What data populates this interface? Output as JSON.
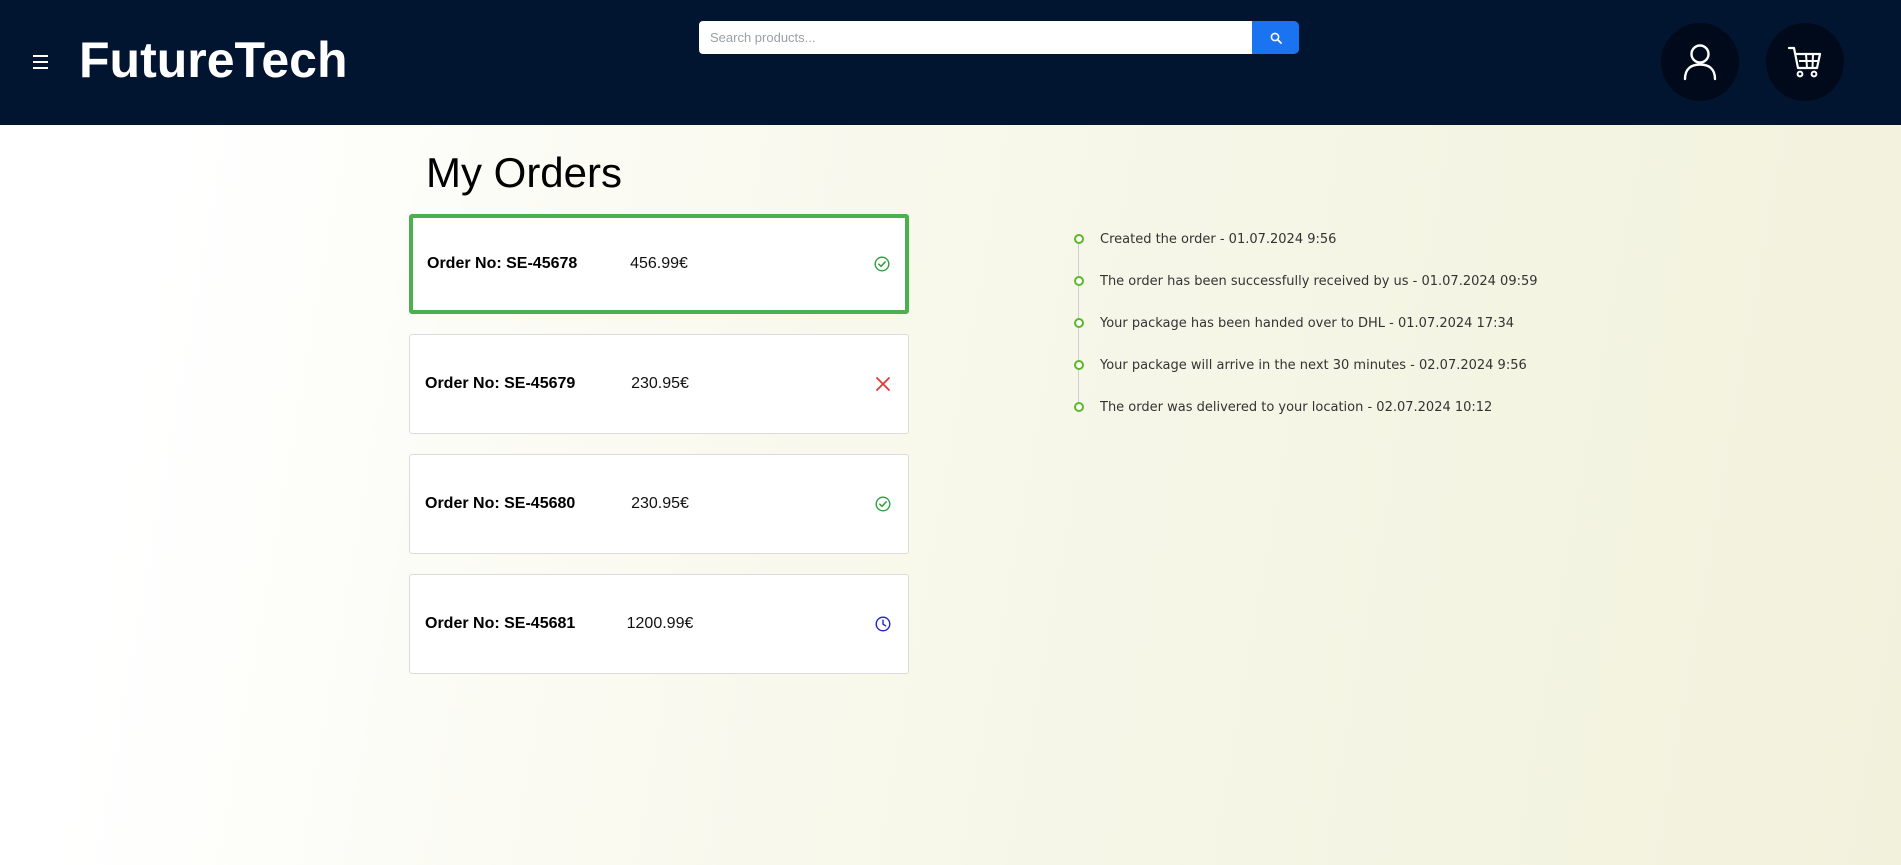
{
  "header": {
    "brand": "FutureTech",
    "search_placeholder": "Search products...",
    "icons": {
      "menu": "hamburger-icon",
      "search": "search-icon",
      "user": "user-icon",
      "cart": "cart-icon"
    },
    "colors": {
      "background": "#021530",
      "search_button": "#1a73f0"
    }
  },
  "page": {
    "title": "My Orders"
  },
  "orders": [
    {
      "number": "Order No: SE-45678",
      "price": "456.99€",
      "status": "delivered",
      "status_icon": "check-circle-icon",
      "status_color": "#2e9e3e",
      "selected": true
    },
    {
      "number": "Order No: SE-45679",
      "price": "230.95€",
      "status": "cancelled",
      "status_icon": "cross-icon",
      "status_color": "#e53935",
      "selected": false
    },
    {
      "number": "Order No: SE-45680",
      "price": "230.95€",
      "status": "delivered",
      "status_icon": "check-circle-icon",
      "status_color": "#2e9e3e",
      "selected": false
    },
    {
      "number": "Order No: SE-45681",
      "price": "1200.99€",
      "status": "pending",
      "status_icon": "clock-icon",
      "status_color": "#2020d0",
      "selected": false
    }
  ],
  "timeline": {
    "dot_color": "#5bb827",
    "events": [
      "Created the order - 01.07.2024 9:56",
      "The order has been successfully received by us - 01.07.2024 09:59",
      "Your package has been handed over to DHL - 01.07.2024 17:34",
      "Your package will arrive in the next 30 minutes - 02.07.2024 9:56",
      "The order was delivered to your location - 02.07.2024 10:12"
    ]
  }
}
